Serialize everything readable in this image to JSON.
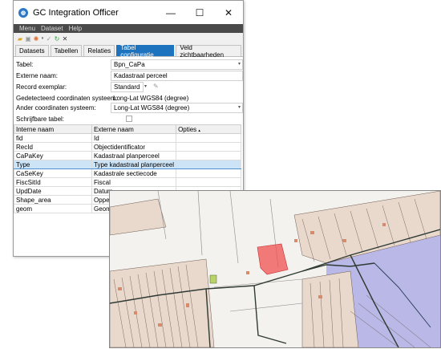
{
  "window": {
    "title": "GC Integration Officer",
    "controls": {
      "minimize": "—",
      "maximize": "☐",
      "close": "✕"
    }
  },
  "menu": [
    "Menu",
    "Dataset",
    "Help"
  ],
  "toolbar": [
    "folder-icon",
    "save-icon",
    "gear-icon",
    "check-icon",
    "refresh-icon",
    "delete-icon"
  ],
  "tabs": [
    {
      "label": "Datasets",
      "active": false
    },
    {
      "label": "Tabellen",
      "active": false
    },
    {
      "label": "Relaties",
      "active": false
    },
    {
      "label": "Tabel configuratie",
      "active": true
    },
    {
      "label": "Veld zichtbaarheden",
      "active": false
    }
  ],
  "form": {
    "tabel_label": "Tabel:",
    "tabel_value": "Bpn_CaPa",
    "externe_naam_label": "Externe naam:",
    "externe_naam_value": "Kadastraal perceel",
    "record_label": "Record exemplar:",
    "record_value": "Standard",
    "gedetecteerd_label": "Gedetecteerd coordinaten systeem:",
    "gedetecteerd_value": "Long-Lat WGS84 (degree)",
    "ander_label": "Ander coordinaten systeem:",
    "ander_value": "Long-Lat WGS84 (degree)",
    "schrijfbaar_label": "Schrijfbare tabel:"
  },
  "grid": {
    "headers": [
      "Interne naam",
      "Externe naam",
      "Opties"
    ],
    "rows": [
      {
        "intern": "fid",
        "extern": "Id"
      },
      {
        "intern": "RecId",
        "extern": "Objectidentificator"
      },
      {
        "intern": "CaPaKey",
        "extern": "Kadastraal planperceel"
      },
      {
        "intern": "Type",
        "extern": "Type kadastraal planperceel"
      },
      {
        "intern": "CaSeKey",
        "extern": "Kadastrale sectiecode"
      },
      {
        "intern": "FiscSitId",
        "extern": "Fiscal"
      },
      {
        "intern": "UpdDate",
        "extern": "Datum"
      },
      {
        "intern": "Shape_area",
        "extern": "Oppe"
      },
      {
        "intern": "geom",
        "extern": "Geom"
      }
    ]
  },
  "colors": {
    "accent": "#1e73be",
    "map_water": "#b9b8e6",
    "map_highlight": "#f05050",
    "parcel_fill": "#d98a6a"
  }
}
